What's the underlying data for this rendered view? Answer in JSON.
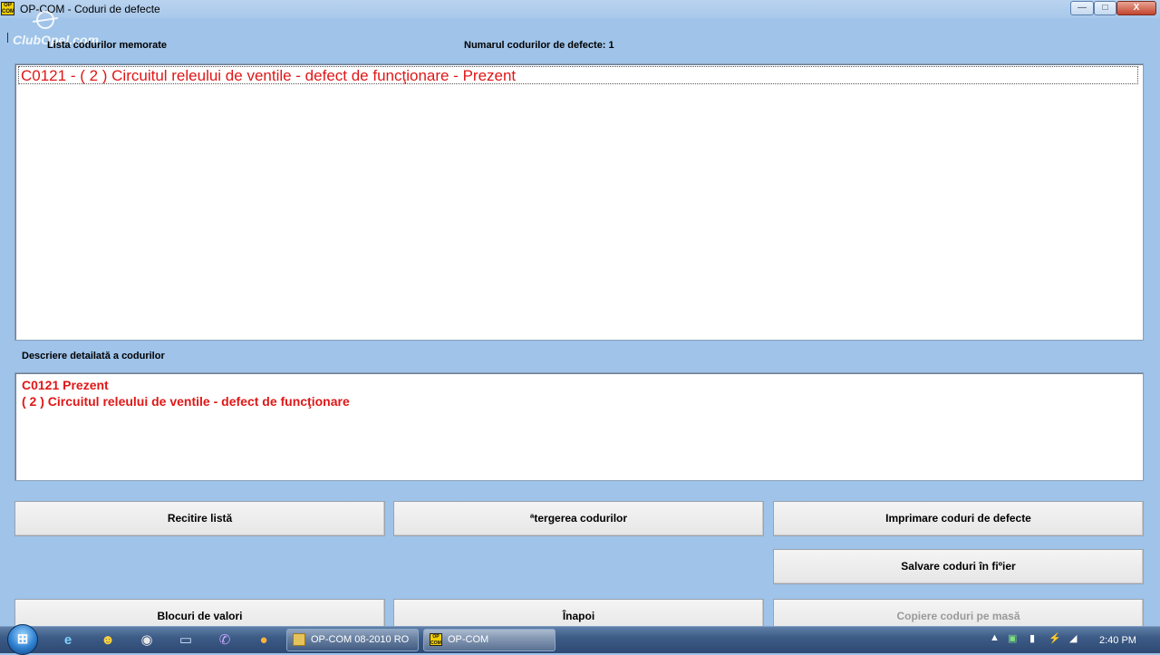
{
  "window": {
    "title": "OP-COM - Coduri de defecte",
    "app_icon_text_top": "OP",
    "app_icon_text_bottom": "COM",
    "minimize": "—",
    "maximize": "□",
    "close": "X"
  },
  "watermark": "ClubOpel.com",
  "header": {
    "list_label": "Lista codurilor memorate",
    "count_label": "Numarul codurilor de defecte: 1"
  },
  "fault_list": [
    "C0121 - ( 2 )  Circuitul releului de ventile - defect de funcţionare - Prezent"
  ],
  "description": {
    "label": "Descriere detailată a codurilor",
    "lines": [
      "C0121  Prezent",
      "( 2 )  Circuitul releului de ventile - defect de funcţionare"
    ]
  },
  "buttons": {
    "reread": "Recitire listă",
    "clear": "ªtergerea codurilor",
    "print": "Imprimare coduri de defecte",
    "save": "Salvare coduri în fiºier",
    "blocks": "Blocuri de valori",
    "back": "Înapoi",
    "copy": "Copiere coduri pe masă"
  },
  "taskbar": {
    "start_icon": "windows-start",
    "pinned": [
      "internet-explorer-icon",
      "smiley-icon",
      "chrome-icon",
      "monitor-icon",
      "viber-icon",
      "orange-ball-icon"
    ],
    "tasks": [
      {
        "label": "OP-COM 08-2010 RO",
        "icon": "folder-icon"
      },
      {
        "label": "OP-COM",
        "icon": "opcom-icon"
      }
    ],
    "clock": "2:40 PM"
  }
}
